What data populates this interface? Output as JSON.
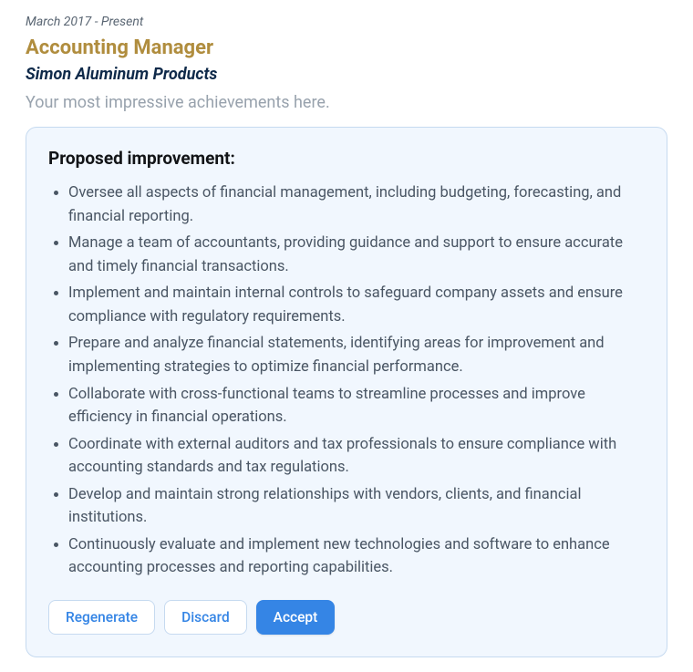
{
  "job": {
    "date_range": "March 2017 - Present",
    "title": "Accounting Manager",
    "company": "Simon Aluminum Products",
    "placeholder": "Your most impressive achievements here."
  },
  "improvement": {
    "heading": "Proposed improvement:",
    "items": [
      "Oversee all aspects of financial management, including budgeting, forecasting, and financial reporting.",
      "Manage a team of accountants, providing guidance and support to ensure accurate and timely financial transactions.",
      "Implement and maintain internal controls to safeguard company assets and ensure compliance with regulatory requirements.",
      "Prepare and analyze financial statements, identifying areas for improvement and implementing strategies to optimize financial performance.",
      "Collaborate with cross-functional teams to streamline processes and improve efficiency in financial operations.",
      "Coordinate with external auditors and tax professionals to ensure compliance with accounting standards and tax regulations.",
      "Develop and maintain strong relationships with vendors, clients, and financial institutions.",
      "Continuously evaluate and implement new technologies and software to enhance accounting processes and reporting capabilities."
    ]
  },
  "buttons": {
    "regenerate": "Regenerate",
    "discard": "Discard",
    "accept": "Accept"
  }
}
